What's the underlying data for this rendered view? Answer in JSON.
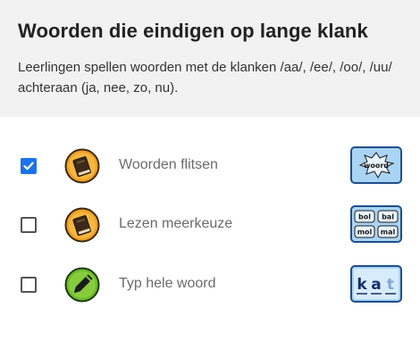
{
  "page": {
    "title": "Woorden die eindigen op lange klank",
    "description": "Leerlingen spellen woorden met de klanken /aa/, /ee/, /oo/, /uu/ achteraan (ja, nee, zo, nu)."
  },
  "exercises": [
    {
      "label": "Woorden flitsen",
      "checked": true,
      "icon": "book-icon",
      "thumbnail": {
        "word": "woord"
      }
    },
    {
      "label": "Lezen meerkeuze",
      "checked": false,
      "icon": "book-icon",
      "thumbnail": {
        "options": [
          "bol",
          "bal",
          "mol",
          "mal"
        ]
      }
    },
    {
      "label": "Typ hele woord",
      "checked": false,
      "icon": "pencil-icon",
      "thumbnail": {
        "letters": [
          "k",
          "a",
          "t"
        ]
      }
    }
  ],
  "colors": {
    "accent": "#1a73e8",
    "orange_icon": "#f0a020",
    "green_icon": "#6dbb2a",
    "thumb_bg": "#a9d4f5"
  }
}
